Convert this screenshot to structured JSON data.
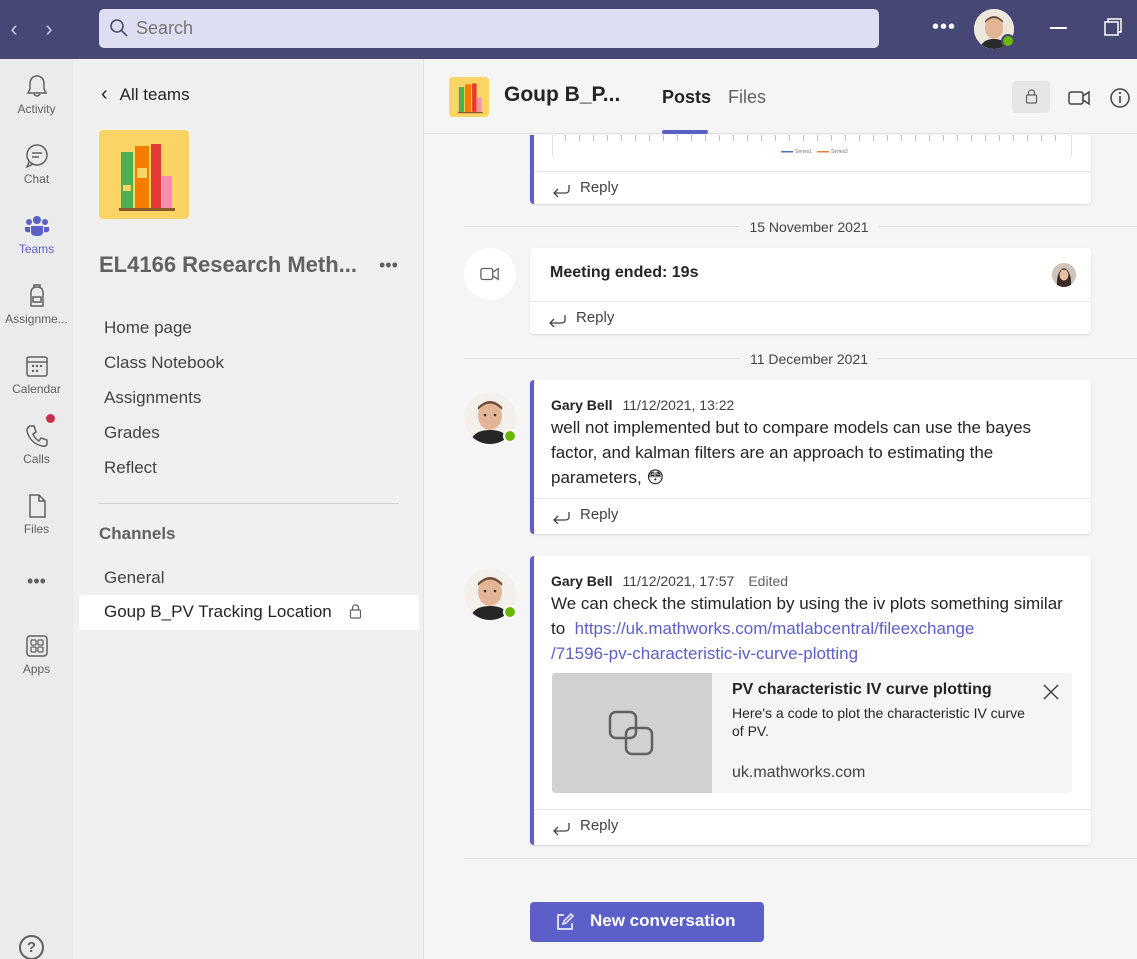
{
  "topbar": {
    "search_placeholder": "Search",
    "more": "•••"
  },
  "rail": {
    "items": [
      {
        "label": "Activity"
      },
      {
        "label": "Chat"
      },
      {
        "label": "Teams"
      },
      {
        "label": "Assignme..."
      },
      {
        "label": "Calendar"
      },
      {
        "label": "Calls"
      },
      {
        "label": "Files"
      },
      {
        "label": "Apps"
      }
    ],
    "more": "•••",
    "help": "?"
  },
  "sidebar": {
    "all_teams": "All teams",
    "team_name": "EL4166 Research Meth...",
    "team_more": "•••",
    "links": [
      "Home page",
      "Class Notebook",
      "Assignments",
      "Grades",
      "Reflect"
    ],
    "channels_heading": "Channels",
    "channels": [
      "General",
      "Goup B_PV Tracking Location"
    ]
  },
  "header": {
    "title": "Goup B_P...",
    "tabs": [
      "Posts",
      "Files"
    ]
  },
  "feed": {
    "reply_label": "Reply",
    "dates": [
      "15 November 2021",
      "11 December 2021"
    ],
    "meeting": {
      "text": "Meeting ended: 19s"
    },
    "messages": [
      {
        "author": "Gary Bell",
        "time": "11/12/2021, 13:22",
        "text": "well not implemented but to compare models can use the bayes factor, and kalman filters are an approach to estimating the parameters,",
        "emoji": "😳"
      },
      {
        "author": "Gary Bell",
        "time": "11/12/2021, 17:57",
        "edited": "Edited",
        "text_before": "We can check the stimulation by using the iv plots something similar to",
        "link": "https://uk.mathworks.com/matlabcentral/fileexchange/71596-pv-characteristic-iv-curve-plotting",
        "link_line1": "https://uk.mathworks.com/matlabcentral/fileexchange",
        "link_line2": "/71596-pv-characteristic-iv-curve-plotting",
        "preview": {
          "title": "PV characteristic IV curve plotting",
          "description": "Here's a code to plot the characteristic IV curve of PV.",
          "domain": "uk.mathworks.com"
        }
      }
    ],
    "chart_legend": [
      "Series1",
      "Series2"
    ]
  },
  "new_conversation": "New conversation",
  "colors": {
    "brand": "#464775",
    "accent": "#5b5fc7",
    "online": "#6bb700",
    "notification": "#c4314b"
  }
}
